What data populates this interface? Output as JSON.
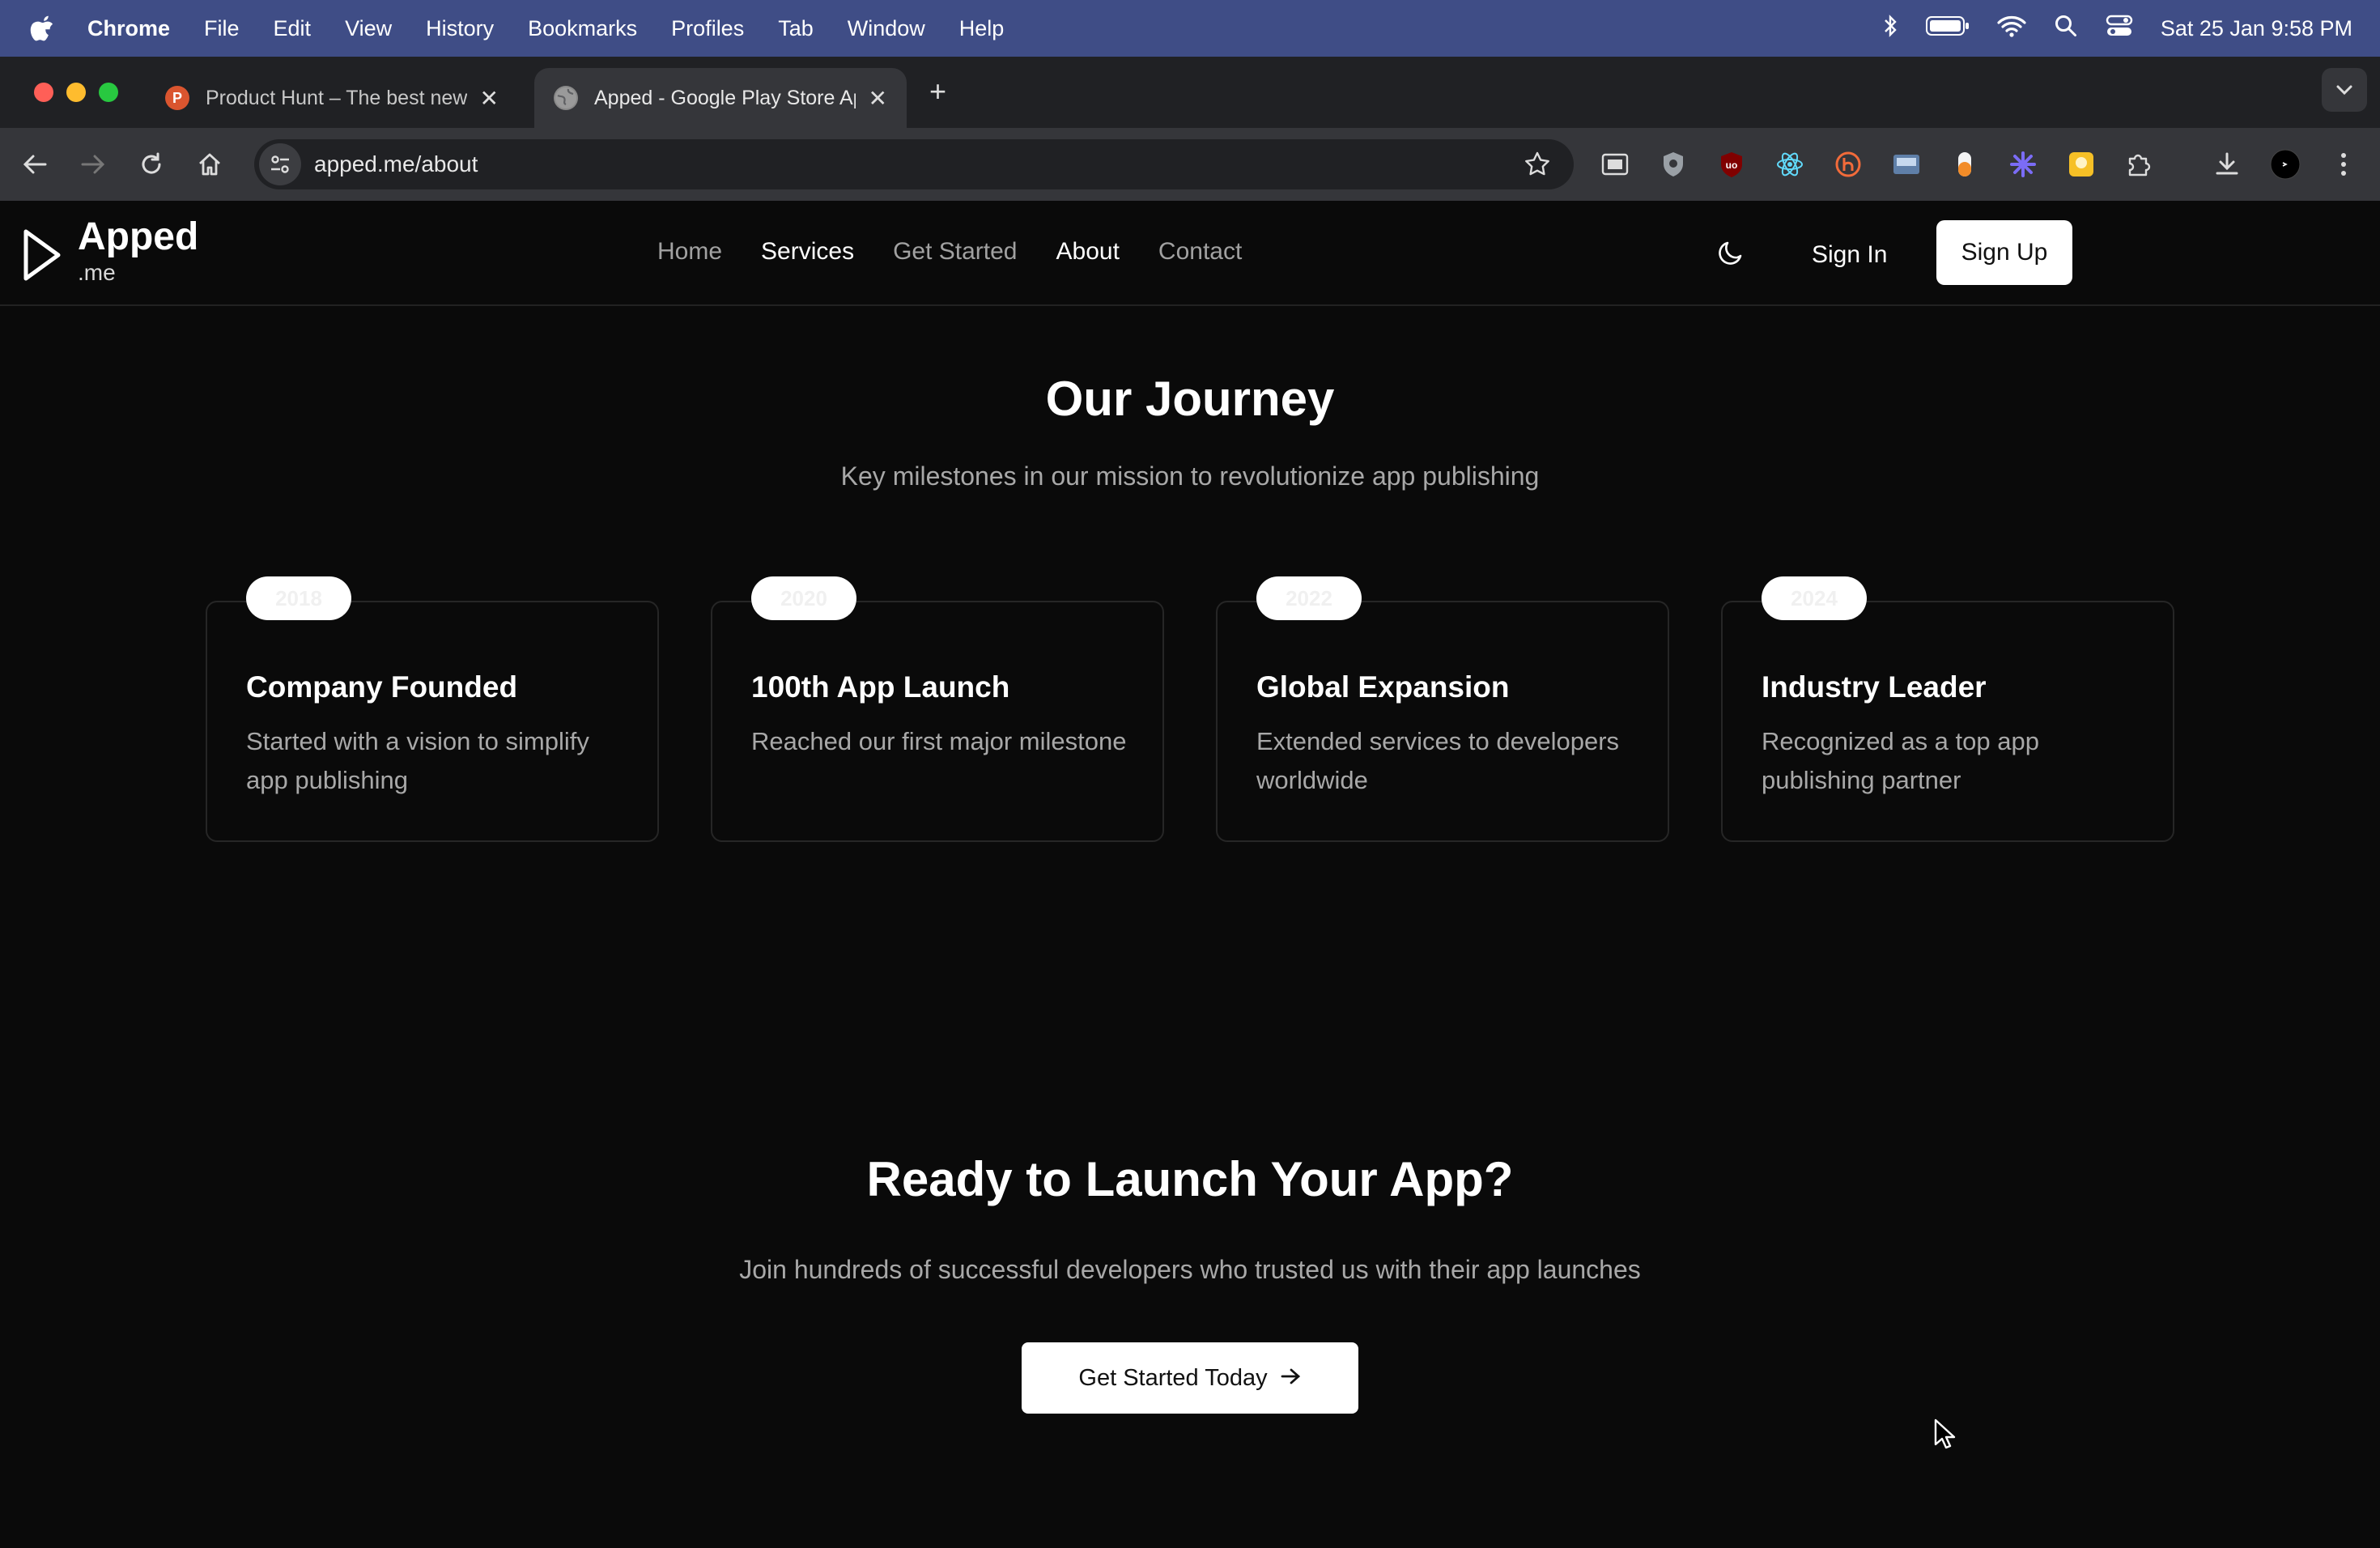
{
  "menubar": {
    "app": "Chrome",
    "items": [
      "File",
      "Edit",
      "View",
      "History",
      "Bookmarks",
      "Profiles",
      "Tab",
      "Window",
      "Help"
    ],
    "clock": "Sat 25 Jan  9:58 PM"
  },
  "tabs": [
    {
      "title": "Product Hunt – The best new",
      "favicon_letter": "P",
      "favicon_color": "#da552f"
    },
    {
      "title": "Apped - Google Play Store Ap",
      "favicon_color": "#8a8a8a"
    }
  ],
  "omnibox": {
    "url": "apped.me/about"
  },
  "site": {
    "brand": "Apped",
    "tld": ".me",
    "nav": [
      {
        "label": "Home",
        "active": false
      },
      {
        "label": "Services",
        "active": true
      },
      {
        "label": "Get Started",
        "active": false
      },
      {
        "label": "About",
        "active": true
      },
      {
        "label": "Contact",
        "active": false
      }
    ],
    "sign_in": "Sign In",
    "sign_up": "Sign Up",
    "journey": {
      "title": "Our Journey",
      "subtitle": "Key milestones in our mission to revolutionize app publishing",
      "milestones": [
        {
          "year": "2018",
          "title": "Company Founded",
          "desc": "Started with a vision to simplify app publishing"
        },
        {
          "year": "2020",
          "title": "100th App Launch",
          "desc": "Reached our first major milestone"
        },
        {
          "year": "2022",
          "title": "Global Expansion",
          "desc": "Extended services to developers worldwide"
        },
        {
          "year": "2024",
          "title": "Industry Leader",
          "desc": "Recognized as a top app publishing partner"
        }
      ]
    },
    "cta": {
      "title": "Ready to Launch Your App?",
      "subtitle": "Join hundreds of successful developers who trusted us with their app launches",
      "button": "Get Started Today"
    }
  },
  "colors": {
    "accent_bg": "#0a0a0a",
    "menubar": "#3f4d86",
    "button_light": "#ffffff"
  }
}
